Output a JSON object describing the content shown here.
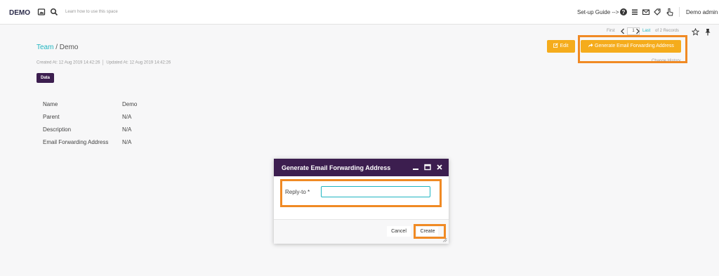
{
  "topbar": {
    "brand": "DEMO",
    "search_hint": "Learn how to use this space",
    "setup_guide": "Set-up Guide -->",
    "user": "Demo admin"
  },
  "pager": {
    "first": "First",
    "page": "1",
    "last": "Last",
    "count": "of 2 Records"
  },
  "breadcrumb": {
    "parent": "Team",
    "separator": " / ",
    "current": "Demo"
  },
  "meta": {
    "created": "Created At: 12 Aug 2019 14:42:26",
    "updated": "Updated At: 12 Aug 2019 14:42:26"
  },
  "tag": "Data",
  "fields": [
    {
      "label": "Name",
      "value": "Demo"
    },
    {
      "label": "Parent",
      "value": "N/A"
    },
    {
      "label": "Description",
      "value": "N/A"
    },
    {
      "label": "Email Forwarding Address",
      "value": "N/A"
    }
  ],
  "actions": {
    "edit": "Edit",
    "generate": "Generate Email Forwarding Address",
    "change_history": "Change History"
  },
  "modal": {
    "title": "Generate Email Forwarding Address",
    "reply_label": "Reply-to",
    "required_mark": "*",
    "reply_value": "",
    "cancel": "Cancel",
    "create": "Create"
  },
  "colors": {
    "accent_purple": "#3c1e4f",
    "action_orange": "#f5ac1c",
    "highlight_frame": "#f08a24",
    "link_teal": "#1fb5c1"
  }
}
